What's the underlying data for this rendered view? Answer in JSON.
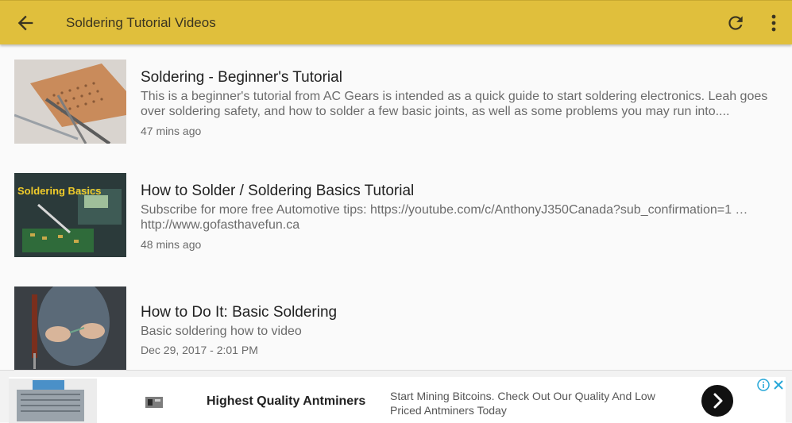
{
  "appbar": {
    "title": "Soldering Tutorial Videos",
    "icons": {
      "back": "arrow-back-icon",
      "refresh": "refresh-icon",
      "more": "more-vert-icon"
    },
    "color": "#e0bf3c"
  },
  "videos": [
    {
      "title": "Soldering - Beginner's Tutorial",
      "description": "This is a beginner's tutorial from AC Gears is intended as a quick guide to start soldering electronics. Leah goes over soldering safety, and how to solder a few basic joints, as well as some problems you may run into....",
      "age": "47 mins ago"
    },
    {
      "title": "How to Solder / Soldering Basics Tutorial",
      "thumb_text": "Soldering Basics",
      "description": "Subscribe for more free Automotive tips: https://youtube.com/c/AnthonyJ350Canada?sub_confirmation=1 … http://www.gofasthavefun.ca",
      "age": "48 mins ago"
    },
    {
      "title": "How to Do It: Basic Soldering",
      "description": "Basic soldering how to video",
      "age": "Dec 29, 2017 - 2:01 PM"
    }
  ],
  "ad": {
    "headline": "Highest Quality Antminers",
    "body": "Start Mining Bitcoins. Check Out Our Quality And Low Priced Antminers Today",
    "icons": {
      "info": "ad-info-icon",
      "close": "ad-close-icon",
      "go": "chevron-right-icon"
    }
  }
}
